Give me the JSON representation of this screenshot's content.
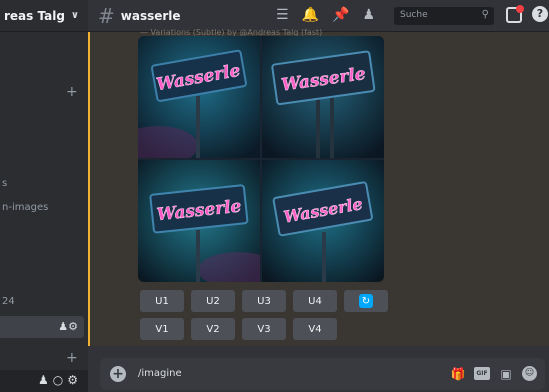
{
  "sidebar": {
    "server_name": "reas Talg",
    "items": [
      {
        "label": "s"
      },
      {
        "label": "n-images"
      },
      {
        "label": "24"
      }
    ]
  },
  "header": {
    "channel_name": "wasserle",
    "search_placeholder": "Suche"
  },
  "message": {
    "header_text": "— Variations (Subtle) by @Andreas Talg (fast)",
    "image_text": [
      "Wasserle",
      "Wasserle",
      "Wasserle",
      "Wasserle"
    ]
  },
  "buttons": {
    "upscale": [
      "U1",
      "U2",
      "U3",
      "U4"
    ],
    "variation": [
      "V1",
      "V2",
      "V3",
      "V4"
    ]
  },
  "composer": {
    "value": "/imagine"
  },
  "colors": {
    "accent_bar": "#f0b232",
    "button_bg": "#4e5058",
    "reroll": "#00a8fc"
  }
}
